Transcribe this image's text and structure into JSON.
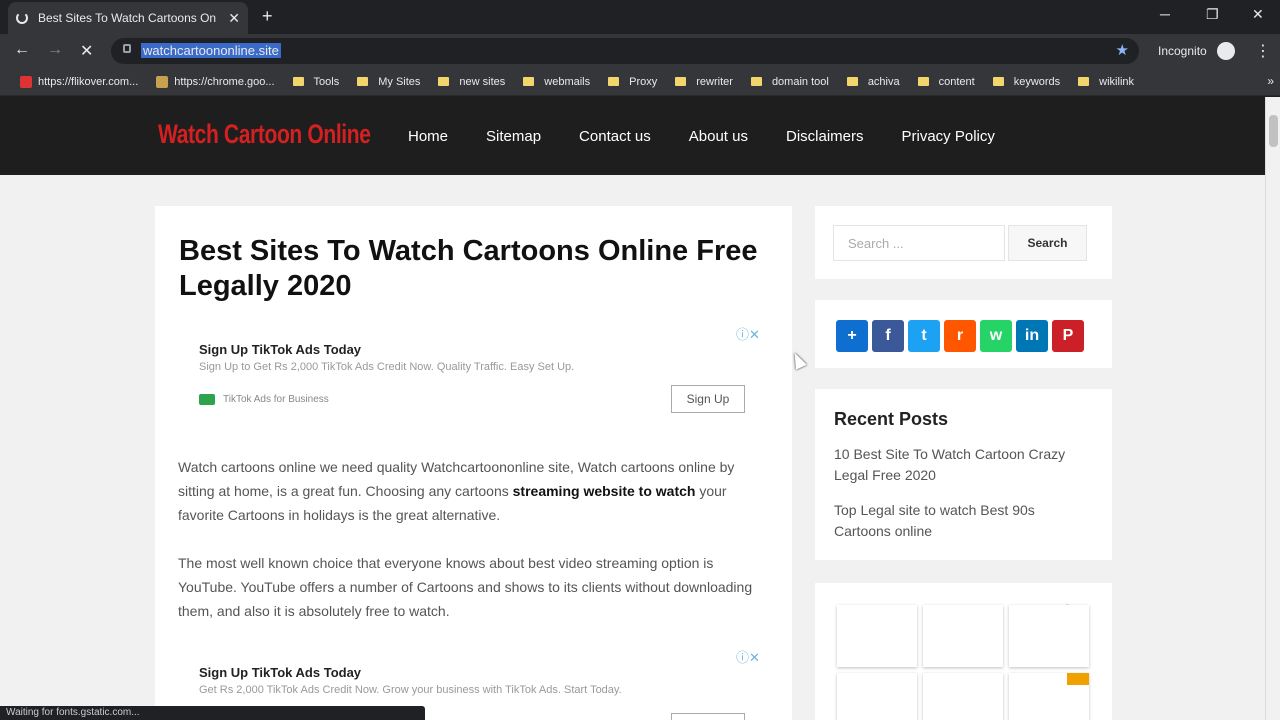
{
  "browser": {
    "tab_title": "Best Sites To Watch Cartoons On",
    "url": "watchcartoononline.site",
    "incognito_label": "Incognito",
    "bookmarks": [
      {
        "label": "https://flikover.com...",
        "kind": "favicon",
        "color": "#d33"
      },
      {
        "label": "https://chrome.goo...",
        "kind": "favicon",
        "color": "#c8a050"
      },
      {
        "label": "Tools",
        "kind": "folder"
      },
      {
        "label": "My Sites",
        "kind": "folder"
      },
      {
        "label": "new sites",
        "kind": "folder"
      },
      {
        "label": "webmails",
        "kind": "folder"
      },
      {
        "label": "Proxy",
        "kind": "folder"
      },
      {
        "label": "rewriter",
        "kind": "folder"
      },
      {
        "label": "domain tool",
        "kind": "folder"
      },
      {
        "label": "achiva",
        "kind": "folder"
      },
      {
        "label": "content",
        "kind": "folder"
      },
      {
        "label": "keywords",
        "kind": "folder"
      },
      {
        "label": "wikilink",
        "kind": "folder"
      }
    ],
    "status_text": "Waiting for fonts.gstatic.com..."
  },
  "site": {
    "logo": "Watch Cartoon Online",
    "nav": [
      "Home",
      "Sitemap",
      "Contact us",
      "About us",
      "Disclaimers",
      "Privacy Policy"
    ]
  },
  "article": {
    "title": "Best Sites To Watch Cartoons Online Free Legally 2020",
    "ad1": {
      "title": "Sign Up TikTok Ads Today",
      "desc": "Sign Up to Get Rs 2,000 TikTok Ads Credit Now. Quality Traffic. Easy Set Up.",
      "brand": "TikTok Ads for Business",
      "button": "Sign Up"
    },
    "para1_start": "Watch cartoons online we need quality Watchcartoononline site, Watch cartoons online by sitting at home, is a great fun. Choosing any cartoons ",
    "para1_bold": "streaming website to watch",
    "para1_end": " your favorite Cartoons in holidays is the great alternative.",
    "para2": "The most well known choice that everyone knows about best video streaming option is YouTube. YouTube offers a number of Cartoons and shows to its clients without downloading them, and also it is absolutely free to watch.",
    "ad2": {
      "title": "Sign Up TikTok Ads Today",
      "desc": "Get Rs 2,000 TikTok Ads Credit Now. Grow your business with TikTok Ads. Start Today."
    }
  },
  "sidebar": {
    "search_placeholder": "Search ...",
    "search_button": "Search",
    "share_buttons": [
      {
        "name": "add-share",
        "glyph": "+",
        "color": "#0f6fd0"
      },
      {
        "name": "facebook",
        "glyph": "f",
        "color": "#3b5998"
      },
      {
        "name": "twitter",
        "glyph": "t",
        "color": "#1da1f2"
      },
      {
        "name": "reddit",
        "glyph": "r",
        "color": "#ff5700"
      },
      {
        "name": "whatsapp",
        "glyph": "w",
        "color": "#25d366"
      },
      {
        "name": "linkedin",
        "glyph": "in",
        "color": "#0077b5"
      },
      {
        "name": "pinterest",
        "glyph": "P",
        "color": "#cb2027"
      }
    ],
    "recent_title": "Recent Posts",
    "recent_posts": [
      "10 Best Site To Watch Cartoon Crazy Legal Free 2020",
      "Top Legal site to watch Best 90s Cartoons online"
    ]
  }
}
